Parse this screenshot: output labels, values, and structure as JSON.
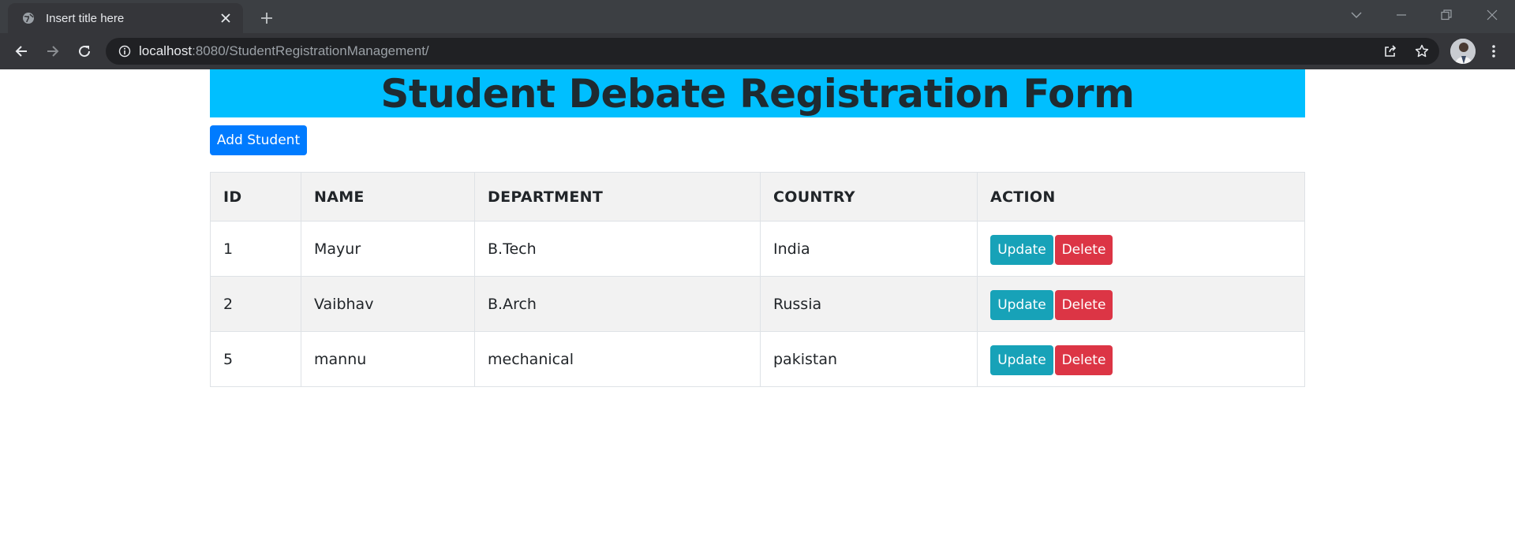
{
  "browser": {
    "tab_title": "Insert title here",
    "url_host": "localhost",
    "url_rest": ":8080/StudentRegistrationManagement/"
  },
  "page": {
    "heading": "Student Debate Registration Form",
    "add_button": "Add Student",
    "columns": [
      "ID",
      "NAME",
      "DEPARTMENT",
      "COUNTRY",
      "ACTION"
    ],
    "rows": [
      {
        "id": "1",
        "name": "Mayur",
        "department": "B.Tech",
        "country": "India"
      },
      {
        "id": "2",
        "name": "Vaibhav",
        "department": "B.Arch",
        "country": "Russia"
      },
      {
        "id": "5",
        "name": "mannu",
        "department": "mechanical",
        "country": "pakistan"
      }
    ],
    "update_label": "Update",
    "delete_label": "Delete"
  },
  "colors": {
    "banner": "#00bfff",
    "primary": "#007bff",
    "info": "#17a2b8",
    "danger": "#dc3545"
  },
  "icons": [
    "globe-icon",
    "close-icon",
    "plus-icon",
    "back-arrow-icon",
    "forward-arrow-icon",
    "reload-icon",
    "info-icon",
    "share-icon",
    "star-icon",
    "kebab-menu-icon",
    "chevron-down-icon",
    "minimize-icon",
    "restore-icon",
    "window-close-icon"
  ]
}
